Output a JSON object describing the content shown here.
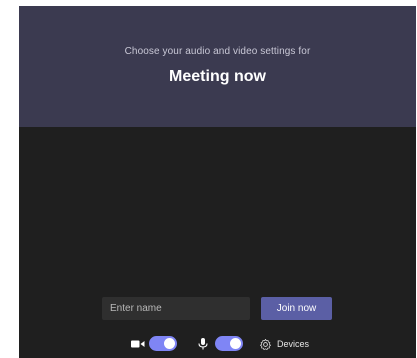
{
  "header": {
    "subtitle": "Choose your audio and video settings for",
    "title": "Meeting now"
  },
  "join": {
    "name_placeholder": "Enter name",
    "name_value": "",
    "join_label": "Join now"
  },
  "controls": {
    "camera": {
      "icon": "video-camera-icon",
      "enabled": true
    },
    "microphone": {
      "icon": "microphone-icon",
      "enabled": true
    },
    "devices": {
      "icon": "gear-icon",
      "label": "Devices"
    }
  },
  "colors": {
    "header_bg": "#3b3a50",
    "body_bg": "#1f1f1f",
    "accent": "#5b5fa5",
    "toggle_on": "#7f85f5"
  }
}
